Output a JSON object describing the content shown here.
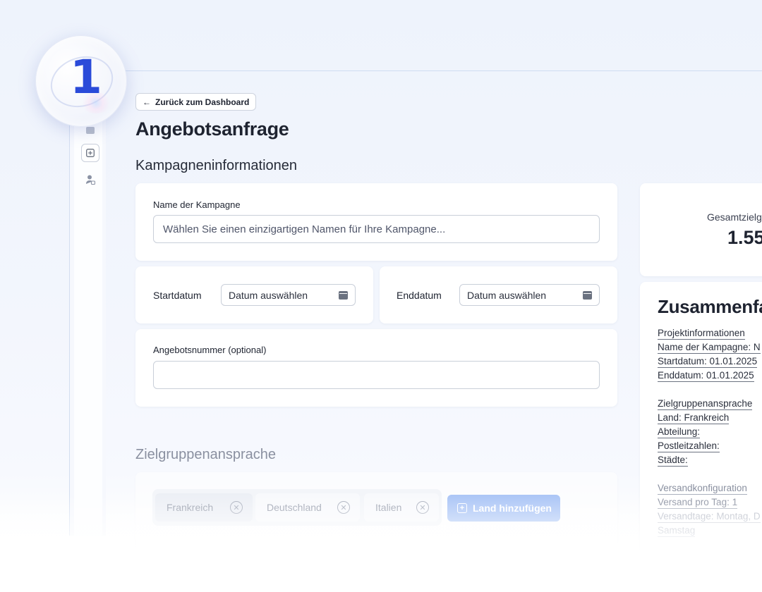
{
  "step": {
    "number": "1"
  },
  "nav": {
    "back_label": "Zurück zum Dashboard",
    "back_arrow": "←"
  },
  "page": {
    "title": "Angebotsanfrage"
  },
  "campaign": {
    "section_title": "Kampagneninformationen",
    "name_label": "Name der Kampagne",
    "name_placeholder": "Wählen Sie einen einzigartigen Namen für Ihre Kampagne...",
    "start_label": "Startdatum",
    "start_value": "Datum auswählen",
    "end_label": "Enddatum",
    "end_value": "Datum auswählen",
    "offer_label": "Angebotsnummer (optional)",
    "offer_value": ""
  },
  "targeting": {
    "section_title": "Zielgruppenansprache",
    "countries": [
      "Frankreich",
      "Deutschland",
      "Italien"
    ],
    "remove_glyph": "✕",
    "add_country_label": "Land hinzufügen",
    "add_glyph": "+"
  },
  "stats": {
    "label": "Gesamtzielg",
    "value": "1.55"
  },
  "summary": {
    "title": "Zusammenfa",
    "project_heading": "Projektinformationen",
    "campaign_name": "Name der Kampagne: N",
    "start": "Startdatum: 01.01.2025",
    "end": "Enddatum: 01.01.2025",
    "targeting_heading": "Zielgruppenansprache",
    "country": "Land: Frankreich",
    "department": "Abteilung:",
    "zip": "Postleitzahlen:",
    "cities": "Städte:",
    "shipping_heading": "Versandkonfiguration",
    "per_day": "Versand pro Tag: 1",
    "days": "Versandtage: Montag, D",
    "saturday": "Samstag"
  }
}
